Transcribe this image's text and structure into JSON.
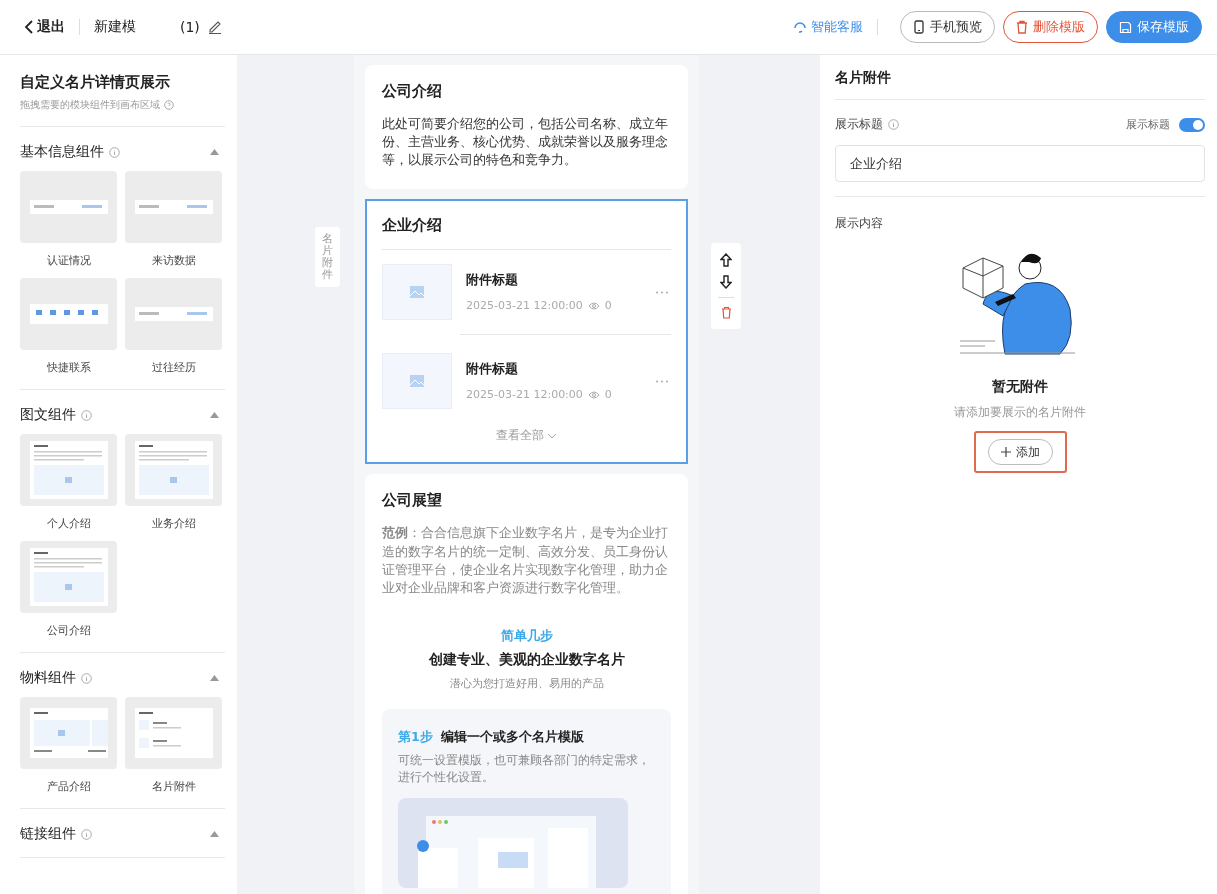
{
  "header": {
    "back_label": "退出",
    "template_name": "新建模",
    "name_suffix": "(1)",
    "support_label": "智能客服",
    "buttons": [
      {
        "label": "手机预览",
        "kind": "outline"
      },
      {
        "label": "删除模版",
        "kind": "danger"
      },
      {
        "label": "保存模版",
        "kind": "primary"
      }
    ]
  },
  "sidebar": {
    "title": "自定义名片详情页展示",
    "hint": "拖拽需要的模块组件到画布区域",
    "groups": [
      {
        "title": "基本信息组件",
        "expanded": true,
        "items": [
          {
            "label": "认证情况",
            "kind": "strip"
          },
          {
            "label": "来访数据",
            "kind": "strip"
          },
          {
            "label": "快捷联系",
            "kind": "icons"
          },
          {
            "label": "过往经历",
            "kind": "strip"
          }
        ]
      },
      {
        "title": "图文组件",
        "expanded": true,
        "items": [
          {
            "label": "个人介绍",
            "kind": "article"
          },
          {
            "label": "业务介绍",
            "kind": "article"
          },
          {
            "label": "公司介绍",
            "kind": "article"
          }
        ]
      },
      {
        "title": "物料组件",
        "expanded": true,
        "items": [
          {
            "label": "产品介绍",
            "kind": "product"
          },
          {
            "label": "名片附件",
            "kind": "attachments"
          }
        ]
      },
      {
        "title": "链接组件",
        "expanded": true
      }
    ]
  },
  "canvas": {
    "side_label": "名片附件",
    "cards": [
      {
        "kind": "text",
        "title": "公司介绍",
        "selected": false,
        "body": "此处可简要介绍您的公司，包括公司名称、成立年份、主营业务、核心优势、成就荣誉以及服务理念等，以展示公司的特色和竞争力。"
      },
      {
        "kind": "attachments",
        "title": "企业介绍",
        "selected": true,
        "more": "查看全部",
        "items": [
          {
            "title": "附件标题",
            "time": "2025-03-21 12:00:00",
            "views": "0"
          },
          {
            "title": "附件标题",
            "time": "2025-03-21 12:00:00",
            "views": "0"
          }
        ]
      },
      {
        "kind": "outlook",
        "title": "公司展望",
        "selected": false,
        "body": "**范例**：合合信息旗下企业数字名片，是专为企业打造的数字名片的统一定制、高效分发、员工身份认证管理平台，使企业名片实现数字化管理，助力企业对企业品牌和客户资源进行数字化管理。",
        "kicker": "简单几步",
        "heading": "创建专业、美观的企业数字名片",
        "subheading": "潜心为您打造好用、易用的产品",
        "step": {
          "number": "第1步",
          "title": "编辑一个或多个名片模版",
          "body": "可统一设置模版，也可兼顾各部门的特定需求，进行个性化设置。"
        }
      }
    ]
  },
  "panel": {
    "title": "名片附件",
    "field_label": "展示标题",
    "toggle_label": "展示标题",
    "toggle_on": true,
    "title_value": "企业介绍",
    "content_label": "展示内容",
    "empty_title": "暂无附件",
    "empty_hint": "请添加要展示的名片附件",
    "add_label": "添加",
    "add_highlighted": true
  }
}
